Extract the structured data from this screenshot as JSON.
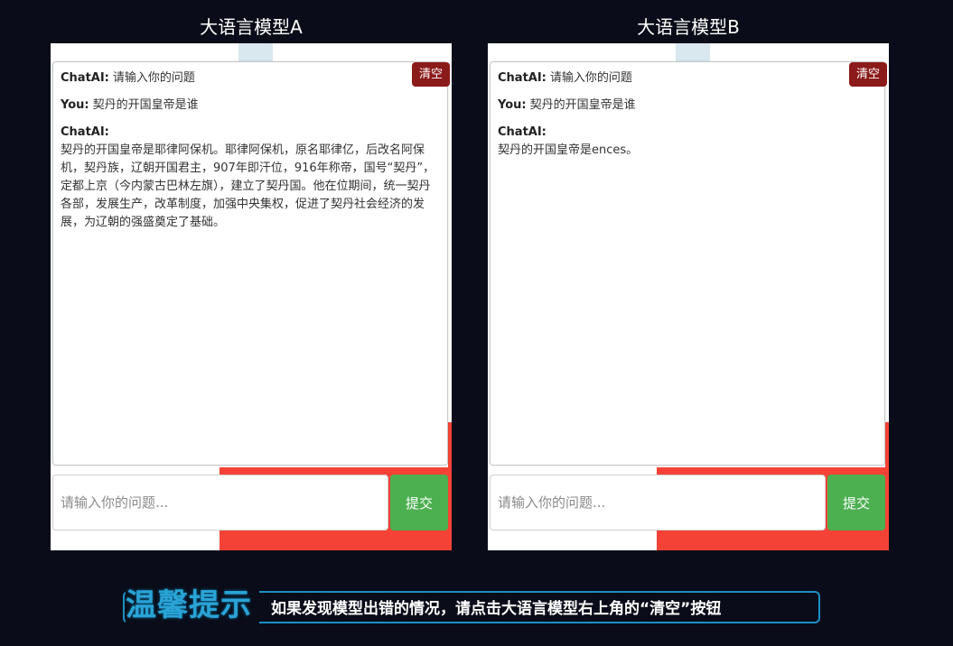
{
  "panels": [
    {
      "title": "大语言模型A",
      "clear_label": "清空",
      "messages": [
        {
          "who": "ChatAI:",
          "text": "请输入你的问题"
        },
        {
          "who": "You:",
          "text": "契丹的开国皇帝是谁"
        },
        {
          "who": "ChatAI:",
          "text": "契丹的开国皇帝是耶律阿保机。耶律阿保机，原名耶律亿，后改名阿保机，契丹族，辽朝开国君主，907年即汗位，916年称帝，国号“契丹”，定都上京（今内蒙古巴林左旗），建立了契丹国。他在位期间，统一契丹各部，发展生产，改革制度，加强中央集权，促进了契丹社会经济的发展，为辽朝的强盛奠定了基础。"
        }
      ],
      "input_placeholder": "请输入你的问题...",
      "submit_label": "提交"
    },
    {
      "title": "大语言模型B",
      "clear_label": "清空",
      "messages": [
        {
          "who": "ChatAI:",
          "text": "请输入你的问题"
        },
        {
          "who": "You:",
          "text": "契丹的开国皇帝是谁"
        },
        {
          "who": "ChatAI:",
          "text": "契丹的开国皇帝是ences。"
        }
      ],
      "input_placeholder": "请输入你的问题...",
      "submit_label": "提交"
    }
  ],
  "tip": {
    "title": "温馨提示",
    "text": "如果发现模型出错的情况，请点击大语言模型右上角的“清空”按钮"
  },
  "colors": {
    "background": "#0a0d19",
    "clear_button": "#8b1a1a",
    "submit_button": "#4caf50",
    "accent_red": "#f44336",
    "tip_border": "#1b8fc4"
  }
}
